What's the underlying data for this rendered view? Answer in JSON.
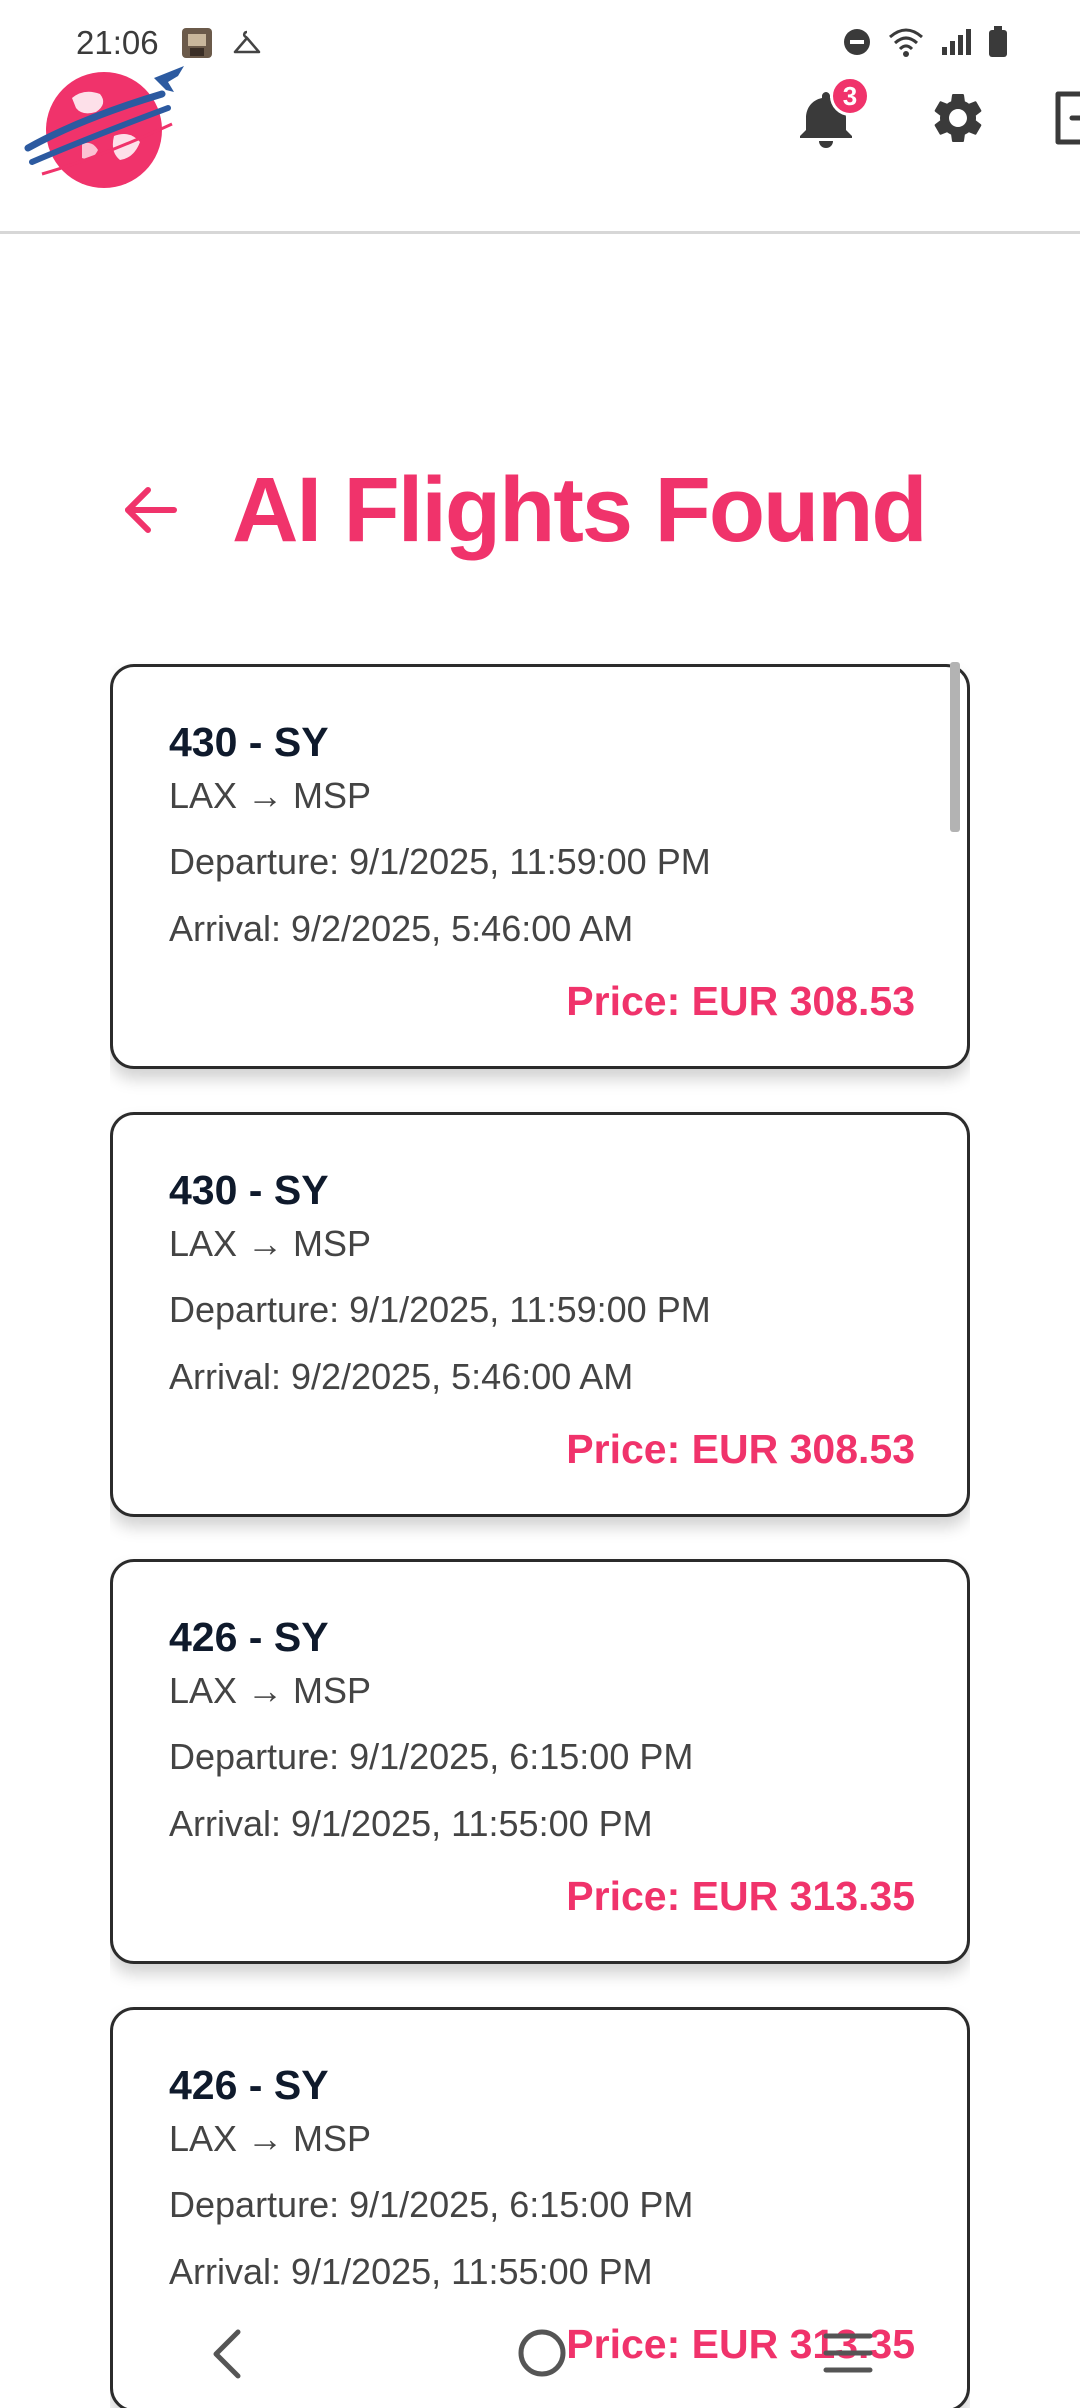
{
  "status_bar": {
    "time": "21:06"
  },
  "header": {
    "notification_count": "3",
    "icons": [
      "logo-globe-plane",
      "bell-icon",
      "gear-icon",
      "logout-icon"
    ]
  },
  "page": {
    "title": "AI Flights Found"
  },
  "flights": [
    {
      "flight": "430 - SY",
      "route": "LAX → MSP",
      "departure": "Departure: 9/1/2025, 11:59:00 PM",
      "arrival": "Arrival: 9/2/2025, 5:46:00 AM",
      "price": "Price: EUR 308.53"
    },
    {
      "flight": "430 - SY",
      "route": "LAX → MSP",
      "departure": "Departure: 9/1/2025, 11:59:00 PM",
      "arrival": "Arrival: 9/2/2025, 5:46:00 AM",
      "price": "Price: EUR 308.53"
    },
    {
      "flight": "426 - SY",
      "route": "LAX → MSP",
      "departure": "Departure: 9/1/2025, 6:15:00 PM",
      "arrival": "Arrival: 9/1/2025, 11:55:00 PM",
      "price": "Price: EUR 313.35"
    },
    {
      "flight": "426 - SY",
      "route": "LAX → MSP",
      "departure": "Departure: 9/1/2025, 6:15:00 PM",
      "arrival": "Arrival: 9/1/2025, 11:55:00 PM",
      "price": "Price: EUR 313.35"
    }
  ],
  "colors": {
    "accent": "#f0336b",
    "text_dark": "#0f1a2c",
    "text_body": "#444444"
  }
}
